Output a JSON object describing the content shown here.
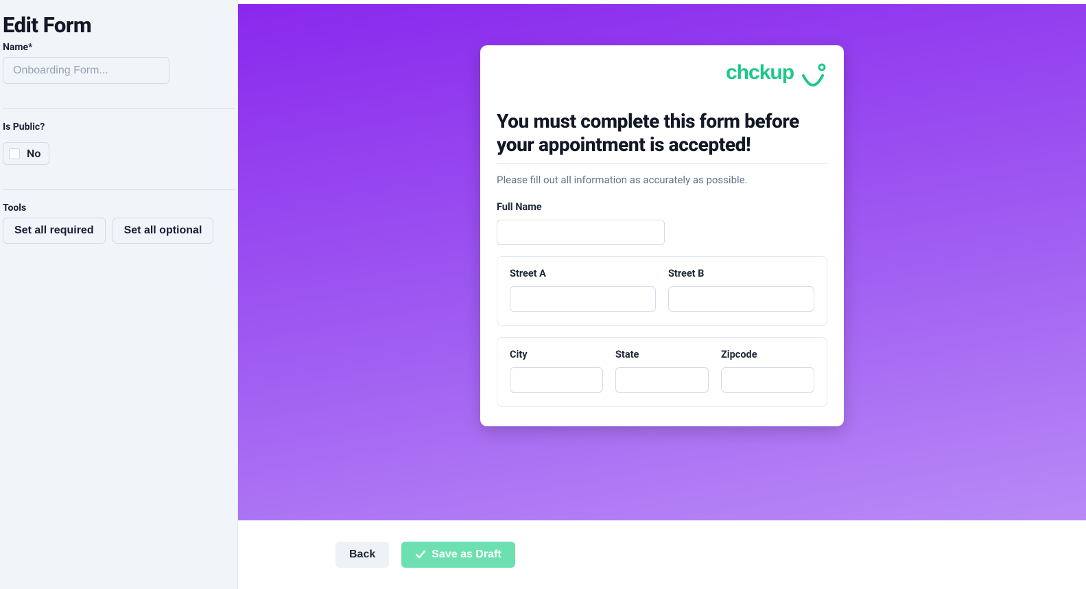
{
  "sidebar": {
    "title": "Edit Form",
    "name_label": "Name*",
    "name_placeholder": "Onboarding Form...",
    "name_value": "",
    "is_public_label": "Is Public?",
    "is_public_value": "No",
    "tools_label": "Tools",
    "set_all_required_label": "Set all required",
    "set_all_optional_label": "Set all optional"
  },
  "form": {
    "brand": "chckup",
    "title": "You must complete this form before your appointment is accepted!",
    "subtitle": "Please fill out all information as accurately as possible.",
    "fields": {
      "full_name_label": "Full Name",
      "street_a_label": "Street A",
      "street_b_label": "Street B",
      "city_label": "City",
      "state_label": "State",
      "zipcode_label": "Zipcode"
    }
  },
  "footer": {
    "back_label": "Back",
    "save_label": "Save as Draft"
  },
  "colors": {
    "accent_green": "#1cc98a",
    "canvas_purple": "#8a28ed",
    "save_button": "#6de0b2"
  }
}
